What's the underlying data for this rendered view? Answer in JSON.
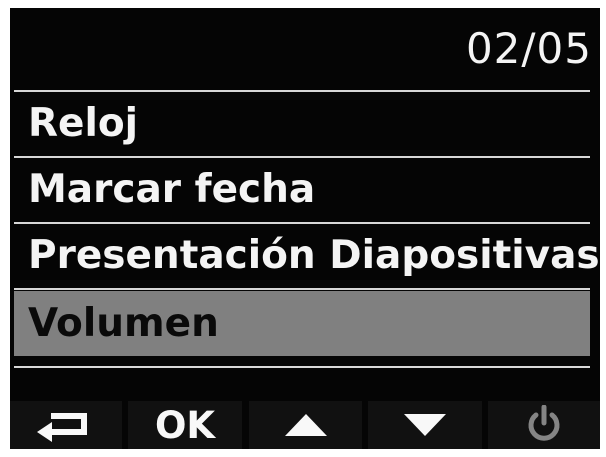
{
  "header": {
    "page_indicator": "02/05"
  },
  "menu": {
    "items": [
      {
        "label": "Reloj",
        "selected": false
      },
      {
        "label": "Marcar fecha",
        "selected": false
      },
      {
        "label": "Presentación Diapositivas",
        "selected": false
      },
      {
        "label": "Volumen",
        "selected": true
      }
    ]
  },
  "softkeys": {
    "back_icon": "return-arrow-icon",
    "ok_label": "OK",
    "up_icon": "up-triangle-icon",
    "down_icon": "down-triangle-icon",
    "power_icon": "power-icon",
    "power_enabled": false
  },
  "colors": {
    "screen_background": "#050505",
    "text": "#f4f4f4",
    "selected_background": "#808080",
    "selected_text": "#0a0a0a",
    "divider": "#d8d8d8",
    "softkey_background": "#111111",
    "disabled_icon": "#858585"
  }
}
